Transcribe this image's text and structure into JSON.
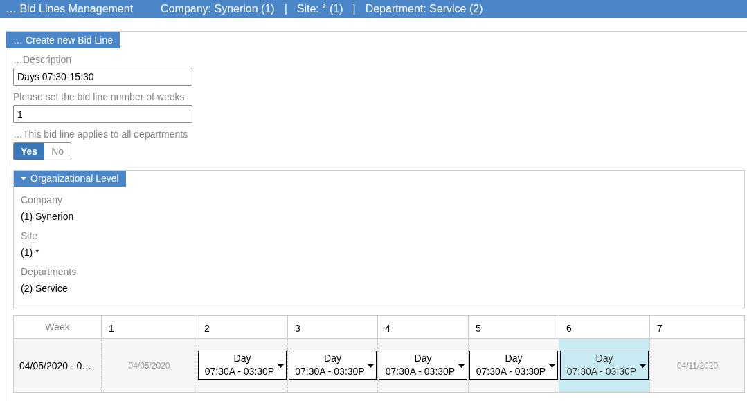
{
  "header": {
    "title": "… Bid Lines Management",
    "separator": "|",
    "filters": [
      "Company: Synerion (1)",
      "Site: * (1)",
      "Department: Service (2)"
    ]
  },
  "panel": {
    "title": "… Create new Bid Line",
    "fields": [
      {
        "label": "…Description",
        "value": "Days 07:30-15:30"
      },
      {
        "label": "Please set the bid line number of weeks",
        "value": "1"
      }
    ],
    "toggle": {
      "label": "…This bid line applies to all departments",
      "options": [
        {
          "label": "Yes",
          "selected": true
        },
        {
          "label": "No",
          "selected": false
        }
      ]
    },
    "org": {
      "title": "Organizational Level",
      "expanded": true,
      "items": [
        {
          "label": "Company",
          "value": "(1) Synerion"
        },
        {
          "label": "Site",
          "value": "(1) *"
        },
        {
          "label": "Departments",
          "value": "(2) Service"
        }
      ]
    },
    "grid": {
      "week_header": "Week",
      "columns": [
        "1",
        "2",
        "3",
        "4",
        "5",
        "6",
        "7"
      ],
      "row": {
        "week": "04/05/2020 - 0…",
        "cells": [
          {
            "kind": "date",
            "text": "04/05/2020"
          },
          {
            "kind": "shift",
            "name": "Day",
            "time": "07:30A - 03:30P",
            "selected": false
          },
          {
            "kind": "shift",
            "name": "Day",
            "time": "07:30A - 03:30P",
            "selected": false
          },
          {
            "kind": "shift",
            "name": "Day",
            "time": "07:30A - 03:30P",
            "selected": false
          },
          {
            "kind": "shift",
            "name": "Day",
            "time": "07:30A - 03:30P",
            "selected": false
          },
          {
            "kind": "shift",
            "name": "Day",
            "time": "07:30A - 03:30P",
            "selected": true
          },
          {
            "kind": "date",
            "text": "04/11/2020"
          }
        ]
      }
    }
  }
}
